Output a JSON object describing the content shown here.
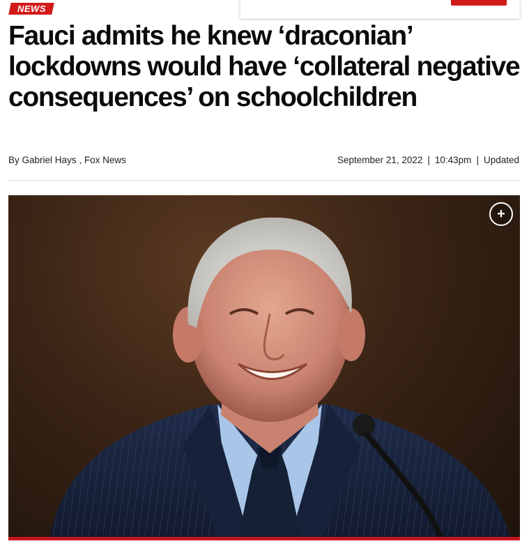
{
  "section_tag": "NEWS",
  "headline": "Fauci admits he knew ‘draconian’ lockdowns would have ‘collateral negative consequences’ on schoolchildren",
  "byline": {
    "prefix": "By",
    "author": "Gabriel Hays",
    "separator": ",",
    "outlet": "Fox News"
  },
  "dateline": {
    "date": "September 21, 2022",
    "time": "10:43pm",
    "updated": "Updated",
    "divider": "|"
  },
  "photo": {
    "subject": "smiling older man in navy pinstripe suit at a microphone",
    "expand_icon": "plus-circle-icon"
  },
  "colors": {
    "brand_red": "#d11a1a",
    "text": "#0b0b0b"
  }
}
